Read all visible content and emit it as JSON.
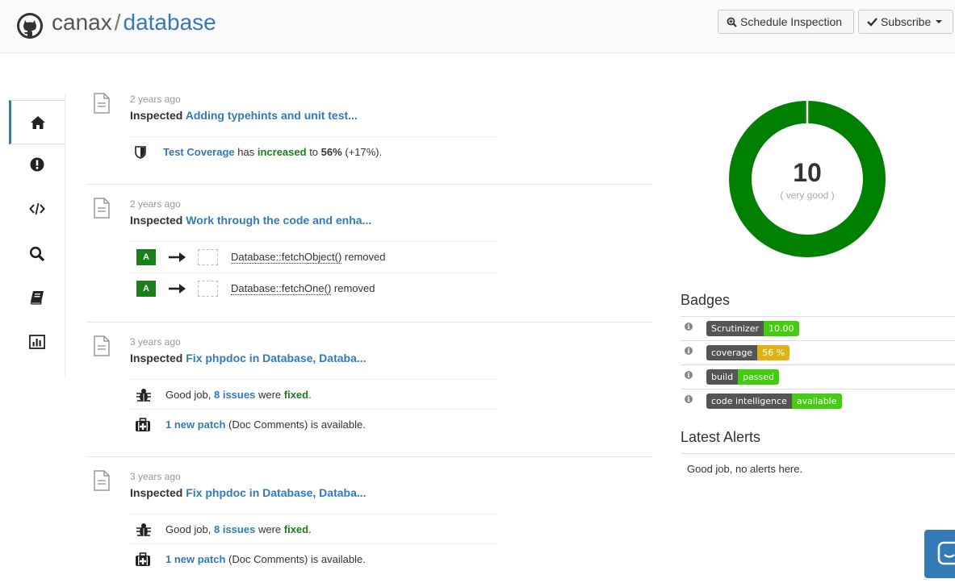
{
  "header": {
    "owner": "canax",
    "separator": "/",
    "repo": "database",
    "schedule_label": "Schedule Inspection",
    "subscribe_label": "Subscribe"
  },
  "nav": [
    {
      "icon": "home-icon",
      "active": true
    },
    {
      "icon": "alert-icon"
    },
    {
      "icon": "code-icon"
    },
    {
      "icon": "search-icon"
    },
    {
      "icon": "book-icon"
    },
    {
      "icon": "chart-icon"
    }
  ],
  "events": [
    {
      "time": "2 years ago",
      "prefix": "Inspected",
      "title": "Adding typehints and unit test...",
      "coverage": {
        "metric": "Test Coverage",
        "has": "has",
        "direction": "increased",
        "to": "to",
        "value": "56%",
        "delta": "(+17%)."
      }
    },
    {
      "time": "2 years ago",
      "prefix": "Inspected",
      "title": "Work through the code and enha...",
      "changes": [
        {
          "grade": "A",
          "name": "Database::fetchObject()",
          "status": "removed"
        },
        {
          "grade": "A",
          "name": "Database::fetchOne()",
          "status": "removed"
        }
      ]
    },
    {
      "time": "3 years ago",
      "prefix": "Inspected",
      "title": "Fix phpdoc in Database, Databa...",
      "fixed": {
        "pre": "Good job,",
        "count": "8 issues",
        "mid": "were",
        "word": "fixed",
        "end": "."
      },
      "patch": {
        "link": "1 new patch",
        "rest": "(Doc Comments) is available."
      }
    },
    {
      "time": "3 years ago",
      "prefix": "Inspected",
      "title": "Fix phpdoc in Database, Databa...",
      "fixed": {
        "pre": "Good job,",
        "count": "8 issues",
        "mid": "were",
        "word": "fixed",
        "end": "."
      },
      "patch": {
        "link": "1 new patch",
        "rest": "(Doc Comments) is available."
      }
    }
  ],
  "score": {
    "value": "10",
    "label": "( very good )",
    "fraction": 1.0,
    "color": "#008000"
  },
  "badges_title": "Badges",
  "badges": [
    {
      "left": "Scrutinizer",
      "right": "10.00",
      "color": "#4c1"
    },
    {
      "left": "coverage",
      "right": "56 %",
      "color": "#dfb317"
    },
    {
      "left": "build",
      "right": "passed",
      "color": "#4c1"
    },
    {
      "left": "code intelligence",
      "right": "available",
      "color": "#4c1"
    }
  ],
  "alerts_title": "Latest Alerts",
  "alerts_text": "Good job, no alerts here."
}
